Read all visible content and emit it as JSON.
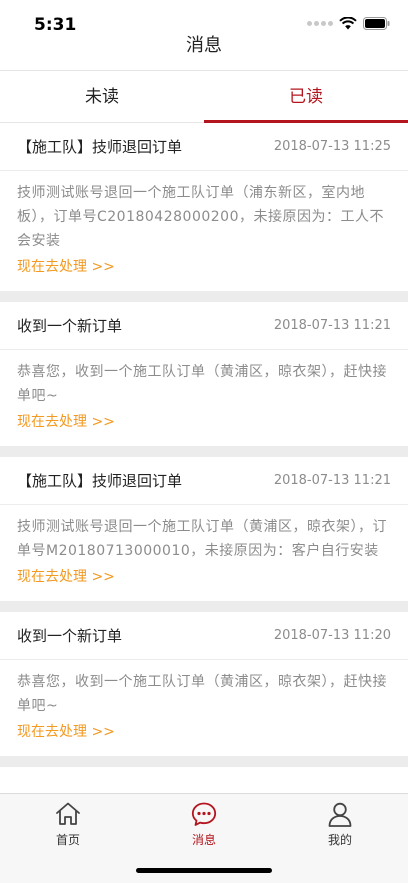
{
  "status_bar": {
    "time": "5:31"
  },
  "nav": {
    "title": "消息"
  },
  "tabs": [
    {
      "label": "未读",
      "active": false
    },
    {
      "label": "已读",
      "active": true
    }
  ],
  "messages": [
    {
      "title": "【施工队】技师退回订单",
      "time": "2018-07-13 11:25",
      "body": "技师测试账号退回一个施工队订单（浦东新区，室内地板），订单号C20180428000200，未接原因为：工人不会安装",
      "link": "现在去处理 >>"
    },
    {
      "title": "收到一个新订单",
      "time": "2018-07-13 11:21",
      "body": "恭喜您，收到一个施工队订单（黄浦区，晾衣架），赶快接单吧~",
      "link": "现在去处理 >>"
    },
    {
      "title": "【施工队】技师退回订单",
      "time": "2018-07-13 11:21",
      "body": "技师测试账号退回一个施工队订单（黄浦区，晾衣架），订单号M20180713000010，未接原因为：客户自行安装",
      "link": "现在去处理 >>"
    },
    {
      "title": "收到一个新订单",
      "time": "2018-07-13 11:20",
      "body": "恭喜您，收到一个施工队订单（黄浦区，晾衣架），赶快接单吧~",
      "link": "现在去处理 >>"
    }
  ],
  "tabbar": [
    {
      "label": "首页",
      "icon": "home-icon",
      "active": false
    },
    {
      "label": "消息",
      "icon": "message-icon",
      "active": true
    },
    {
      "label": "我的",
      "icon": "profile-icon",
      "active": false
    }
  ],
  "colors": {
    "accent": "#b3141d",
    "link": "#f29a22",
    "muted": "#8c8c8c"
  }
}
